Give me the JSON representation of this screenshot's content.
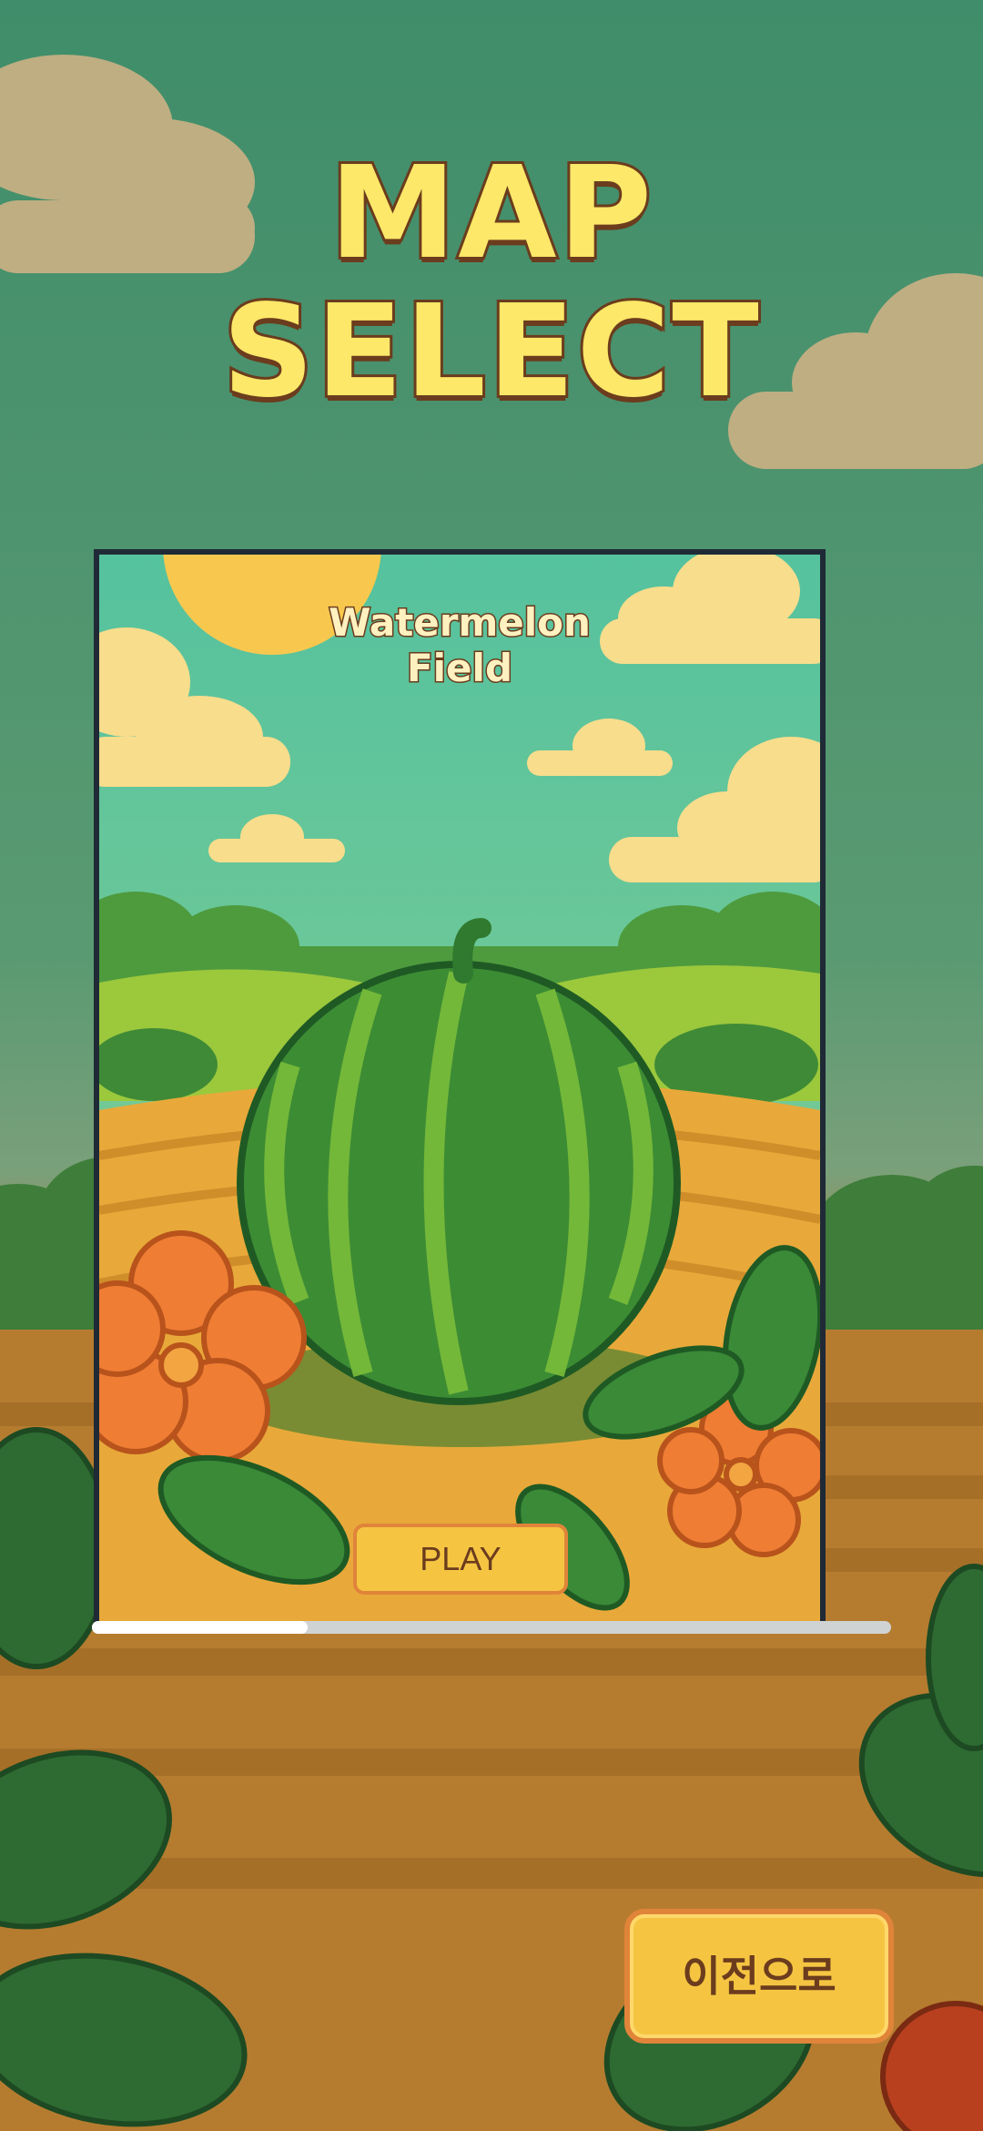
{
  "screen": {
    "title_line1": "MAP",
    "title_line2": "SELECT"
  },
  "map_card": {
    "name_line1": "Watermelon",
    "name_line2": "Field",
    "play_label": "PLAY"
  },
  "carousel": {
    "position_fraction": 0.27
  },
  "footer": {
    "back_label": "이전으로"
  },
  "colors": {
    "button_fill": "#f5c542",
    "button_border": "#e0843a",
    "title_fill": "#fde869",
    "title_outline": "#6b3c1d"
  }
}
